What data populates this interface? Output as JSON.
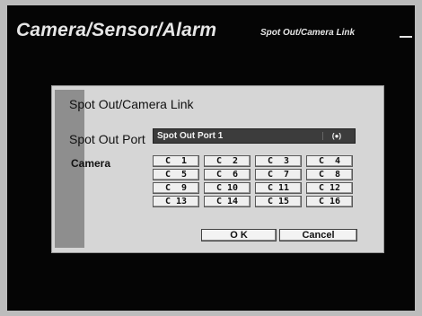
{
  "header": {
    "title": "Camera/Sensor/Alarm",
    "subtitle": "Spot Out/Camera Link"
  },
  "dialog": {
    "title": "Spot Out/Camera Link",
    "spot_out_port": {
      "label": "Spot Out Port",
      "value": "Spot Out Port 1",
      "icon_glyph": "(●)",
      "icon": "dropdown-indicator-icon"
    },
    "camera": {
      "label": "Camera",
      "buttons": [
        "C  1",
        "C  2",
        "C  3",
        "C  4",
        "C  5",
        "C  6",
        "C  7",
        "C  8",
        "C  9",
        "C 10",
        "C 11",
        "C 12",
        "C 13",
        "C 14",
        "C 15",
        "C 16"
      ]
    },
    "ok_label": "O K",
    "cancel_label": "Cancel"
  },
  "colors": {
    "screen_background": "#050505",
    "dialog_background": "#d6d6d6",
    "dialog_stripe": "#8e8e8e",
    "select_background": "#3c3c3c"
  }
}
